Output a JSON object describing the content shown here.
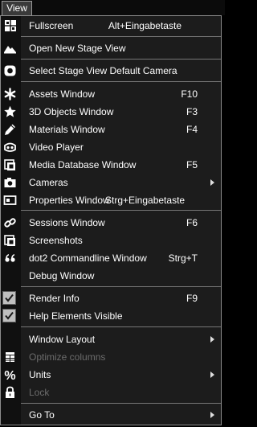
{
  "menubar": {
    "title": "View"
  },
  "menu": {
    "items": [
      {
        "label": "Fullscreen",
        "shortcut": "Alt+Eingabetaste",
        "icon": "grid-icon"
      },
      {
        "label": "Open New Stage View",
        "shortcut": "",
        "icon": "mountain-icon"
      },
      {
        "label": "Select Stage View Default Camera",
        "shortcut": "",
        "icon": "record-icon"
      },
      {
        "label": "Assets Window",
        "shortcut": "F10",
        "icon": "asterisk-icon"
      },
      {
        "label": "3D Objects Window",
        "shortcut": "F3",
        "icon": "star-icon"
      },
      {
        "label": "Materials Window",
        "shortcut": "F4",
        "icon": "pencil-icon"
      },
      {
        "label": "Video Player",
        "shortcut": "",
        "icon": "video-player-icon"
      },
      {
        "label": "Media Database Window",
        "shortcut": "F5",
        "icon": "media-database-icon"
      },
      {
        "label": "Cameras",
        "shortcut": "",
        "icon": "camera-icon"
      },
      {
        "label": "Properties Window",
        "shortcut": "Strg+Eingabetaste",
        "icon": "properties-icon"
      },
      {
        "label": "Sessions Window",
        "shortcut": "F6",
        "icon": "link-icon"
      },
      {
        "label": "Screenshots",
        "shortcut": "",
        "icon": "screenshot-icon"
      },
      {
        "label": "dot2 Commandline Window",
        "shortcut": "Strg+T",
        "icon": "quote-icon"
      },
      {
        "label": "Debug Window",
        "shortcut": "",
        "icon": ""
      },
      {
        "label": "Render Info",
        "shortcut": "F9",
        "checked": true
      },
      {
        "label": "Help Elements Visible",
        "shortcut": "",
        "checked": true
      },
      {
        "label": "Window Layout",
        "shortcut": "",
        "submenu": true
      },
      {
        "label": "Optimize columns",
        "shortcut": "",
        "disabled": true,
        "icon": "columns-icon"
      },
      {
        "label": "Units",
        "shortcut": "",
        "submenu": true,
        "icon": "percent-icon"
      },
      {
        "label": "Lock",
        "shortcut": "",
        "disabled": true,
        "icon": "lock-icon"
      },
      {
        "label": "Go To",
        "shortcut": "",
        "submenu": true
      }
    ]
  }
}
